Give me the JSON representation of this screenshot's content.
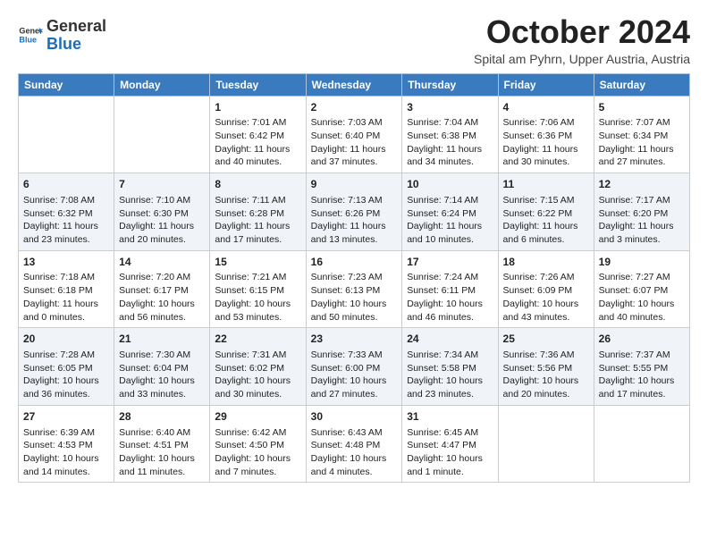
{
  "header": {
    "logo_text_general": "General",
    "logo_text_blue": "Blue",
    "month": "October 2024",
    "location": "Spital am Pyhrn, Upper Austria, Austria"
  },
  "weekdays": [
    "Sunday",
    "Monday",
    "Tuesday",
    "Wednesday",
    "Thursday",
    "Friday",
    "Saturday"
  ],
  "weeks": [
    [
      {
        "day": "",
        "info": ""
      },
      {
        "day": "",
        "info": ""
      },
      {
        "day": "1",
        "info": "Sunrise: 7:01 AM\nSunset: 6:42 PM\nDaylight: 11 hours and 40 minutes."
      },
      {
        "day": "2",
        "info": "Sunrise: 7:03 AM\nSunset: 6:40 PM\nDaylight: 11 hours and 37 minutes."
      },
      {
        "day": "3",
        "info": "Sunrise: 7:04 AM\nSunset: 6:38 PM\nDaylight: 11 hours and 34 minutes."
      },
      {
        "day": "4",
        "info": "Sunrise: 7:06 AM\nSunset: 6:36 PM\nDaylight: 11 hours and 30 minutes."
      },
      {
        "day": "5",
        "info": "Sunrise: 7:07 AM\nSunset: 6:34 PM\nDaylight: 11 hours and 27 minutes."
      }
    ],
    [
      {
        "day": "6",
        "info": "Sunrise: 7:08 AM\nSunset: 6:32 PM\nDaylight: 11 hours and 23 minutes."
      },
      {
        "day": "7",
        "info": "Sunrise: 7:10 AM\nSunset: 6:30 PM\nDaylight: 11 hours and 20 minutes."
      },
      {
        "day": "8",
        "info": "Sunrise: 7:11 AM\nSunset: 6:28 PM\nDaylight: 11 hours and 17 minutes."
      },
      {
        "day": "9",
        "info": "Sunrise: 7:13 AM\nSunset: 6:26 PM\nDaylight: 11 hours and 13 minutes."
      },
      {
        "day": "10",
        "info": "Sunrise: 7:14 AM\nSunset: 6:24 PM\nDaylight: 11 hours and 10 minutes."
      },
      {
        "day": "11",
        "info": "Sunrise: 7:15 AM\nSunset: 6:22 PM\nDaylight: 11 hours and 6 minutes."
      },
      {
        "day": "12",
        "info": "Sunrise: 7:17 AM\nSunset: 6:20 PM\nDaylight: 11 hours and 3 minutes."
      }
    ],
    [
      {
        "day": "13",
        "info": "Sunrise: 7:18 AM\nSunset: 6:18 PM\nDaylight: 11 hours and 0 minutes."
      },
      {
        "day": "14",
        "info": "Sunrise: 7:20 AM\nSunset: 6:17 PM\nDaylight: 10 hours and 56 minutes."
      },
      {
        "day": "15",
        "info": "Sunrise: 7:21 AM\nSunset: 6:15 PM\nDaylight: 10 hours and 53 minutes."
      },
      {
        "day": "16",
        "info": "Sunrise: 7:23 AM\nSunset: 6:13 PM\nDaylight: 10 hours and 50 minutes."
      },
      {
        "day": "17",
        "info": "Sunrise: 7:24 AM\nSunset: 6:11 PM\nDaylight: 10 hours and 46 minutes."
      },
      {
        "day": "18",
        "info": "Sunrise: 7:26 AM\nSunset: 6:09 PM\nDaylight: 10 hours and 43 minutes."
      },
      {
        "day": "19",
        "info": "Sunrise: 7:27 AM\nSunset: 6:07 PM\nDaylight: 10 hours and 40 minutes."
      }
    ],
    [
      {
        "day": "20",
        "info": "Sunrise: 7:28 AM\nSunset: 6:05 PM\nDaylight: 10 hours and 36 minutes."
      },
      {
        "day": "21",
        "info": "Sunrise: 7:30 AM\nSunset: 6:04 PM\nDaylight: 10 hours and 33 minutes."
      },
      {
        "day": "22",
        "info": "Sunrise: 7:31 AM\nSunset: 6:02 PM\nDaylight: 10 hours and 30 minutes."
      },
      {
        "day": "23",
        "info": "Sunrise: 7:33 AM\nSunset: 6:00 PM\nDaylight: 10 hours and 27 minutes."
      },
      {
        "day": "24",
        "info": "Sunrise: 7:34 AM\nSunset: 5:58 PM\nDaylight: 10 hours and 23 minutes."
      },
      {
        "day": "25",
        "info": "Sunrise: 7:36 AM\nSunset: 5:56 PM\nDaylight: 10 hours and 20 minutes."
      },
      {
        "day": "26",
        "info": "Sunrise: 7:37 AM\nSunset: 5:55 PM\nDaylight: 10 hours and 17 minutes."
      }
    ],
    [
      {
        "day": "27",
        "info": "Sunrise: 6:39 AM\nSunset: 4:53 PM\nDaylight: 10 hours and 14 minutes."
      },
      {
        "day": "28",
        "info": "Sunrise: 6:40 AM\nSunset: 4:51 PM\nDaylight: 10 hours and 11 minutes."
      },
      {
        "day": "29",
        "info": "Sunrise: 6:42 AM\nSunset: 4:50 PM\nDaylight: 10 hours and 7 minutes."
      },
      {
        "day": "30",
        "info": "Sunrise: 6:43 AM\nSunset: 4:48 PM\nDaylight: 10 hours and 4 minutes."
      },
      {
        "day": "31",
        "info": "Sunrise: 6:45 AM\nSunset: 4:47 PM\nDaylight: 10 hours and 1 minute."
      },
      {
        "day": "",
        "info": ""
      },
      {
        "day": "",
        "info": ""
      }
    ]
  ]
}
